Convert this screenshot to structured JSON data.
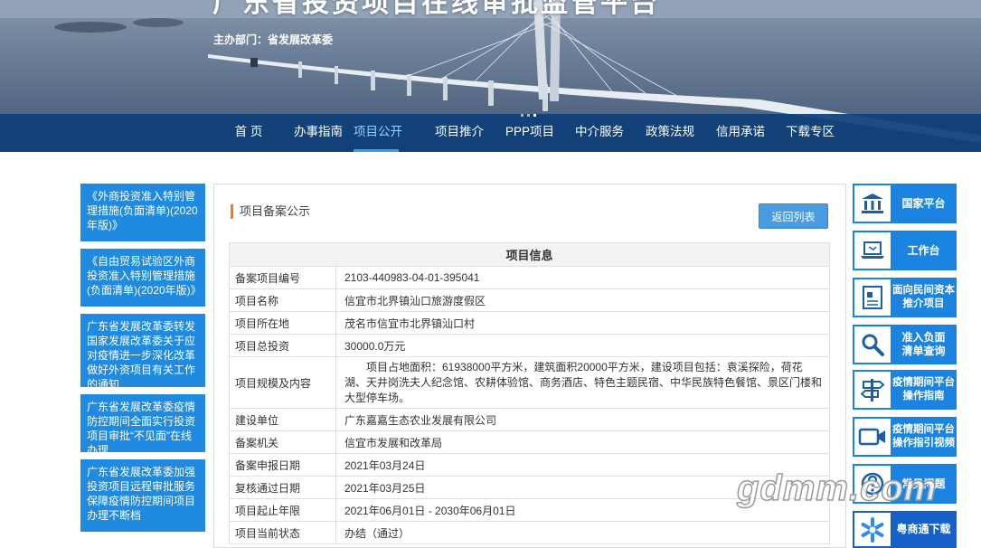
{
  "site": {
    "title": "广东省投资项目在线审批监管平台",
    "org": "主办部门：省发展改革委"
  },
  "nav": [
    "首 页",
    "办事指南",
    "项目公开",
    "项目推介",
    "PPP项目",
    "中介服务",
    "政策法规",
    "信用承诺",
    "下载专区"
  ],
  "nav_active": "项目公开",
  "left_news": [
    "《外商投资准入特别管理措施(负面清单)(2020年版)》",
    "《自由贸易试验区外商投资准入特别管理措施(负面清单)(2020年版)》",
    "广东省发展改革委转发国家发展改革委关于应对疫情进一步深化改革做好外资项目有关工作的通知",
    "广东省发展改革委疫情防控期间全面实行投资项目审批“不见面”在线办理",
    "广东省发展改革委加强投资项目远程审批服务保障疫情防控期间项目办理不断档"
  ],
  "panel": {
    "title": "项目备案公示",
    "back_button": "返回列表",
    "table_header": "项目信息",
    "rows": [
      {
        "label": "备案项目编号",
        "value": "2103-440983-04-01-395041"
      },
      {
        "label": "项目名称",
        "value": "信宜市北界镇汕口旅游度假区"
      },
      {
        "label": "项目所在地",
        "value": "茂名市信宜市北界镇汕口村"
      },
      {
        "label": "项目总投资",
        "value": "30000.0万元"
      },
      {
        "label": "项目规模及内容",
        "value": "项目占地面积：61938000平方米，建筑面积20000平方米，建设项目包括：袁溪探险，荷花湖、天井岗洗夫人纪念馆、农耕体验馆、商务酒店、特色主题民宿、中华民族特色餐馆、景区门楼和大型停车场。"
      },
      {
        "label": "建设单位",
        "value": "广东嘉嘉生态农业发展有限公司"
      },
      {
        "label": "备案机关",
        "value": "信宜市发展和改革局"
      },
      {
        "label": "备案申报日期",
        "value": "2021年03月24日"
      },
      {
        "label": "复核通过日期",
        "value": "2021年03月25日"
      },
      {
        "label": "项目起止年限",
        "value": "2021年06月01日 - 2030年06月01日"
      },
      {
        "label": "项目当前状态",
        "value": "办结（通过）"
      }
    ]
  },
  "right_links": [
    {
      "label": "国家平台",
      "icon": "building-icon"
    },
    {
      "label": "工作台",
      "icon": "laptop-icon"
    },
    {
      "label": "面向民间资本\n推介项目",
      "icon": "document-icon"
    },
    {
      "label": "准入负面\n清单查询",
      "icon": "magnifier-icon"
    },
    {
      "label": "疫情期间平台\n操作指南",
      "icon": "signpost-icon"
    },
    {
      "label": "疫情期间平台\n操作指引视频",
      "icon": "video-camera-icon"
    },
    {
      "label": "常见问题",
      "icon": "question-icon"
    },
    {
      "label": "粤商通下载",
      "icon": "snowflake-logo-icon"
    }
  ],
  "watermark": "gdmm.com"
}
